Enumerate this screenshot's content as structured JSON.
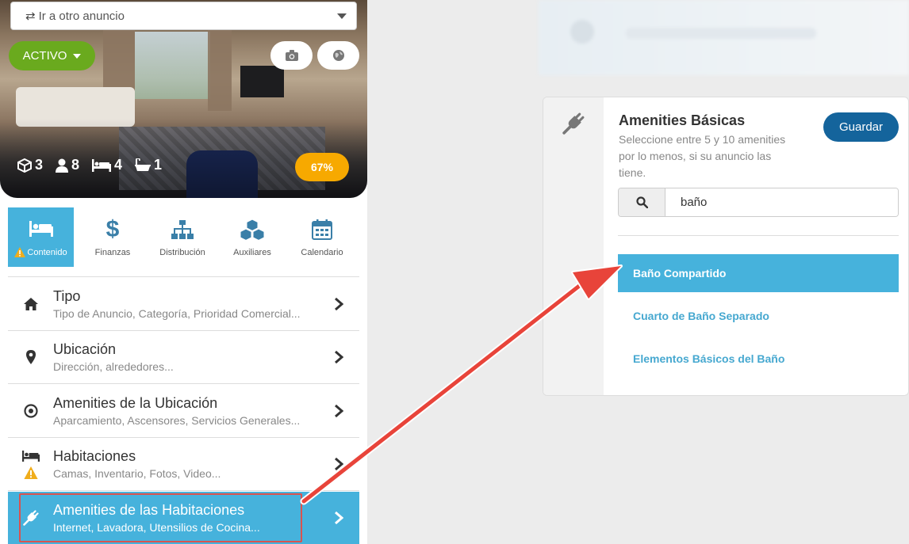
{
  "goto": {
    "label": "Ir a otro anuncio"
  },
  "status": {
    "label": "ACTIVO"
  },
  "stats": [
    {
      "icon": "cube-icon",
      "value": "3"
    },
    {
      "icon": "user-icon",
      "value": "8"
    },
    {
      "icon": "bed-icon",
      "value": "4"
    },
    {
      "icon": "bath-icon",
      "value": "1"
    }
  ],
  "progress": {
    "label": "67%",
    "percent": 67,
    "color": "#f7a900"
  },
  "tabs": [
    {
      "label": "Contenido",
      "icon": "bed-icon",
      "active": true,
      "warning": true
    },
    {
      "label": "Finanzas",
      "icon": "dollar-icon"
    },
    {
      "label": "Distribución",
      "icon": "sitemap-icon"
    },
    {
      "label": "Auxiliares",
      "icon": "cubes-icon"
    },
    {
      "label": "Calendario",
      "icon": "calendar-icon"
    }
  ],
  "menu": [
    {
      "title": "Tipo",
      "subtitle": "Tipo de Anuncio, Categoría, Prioridad Comercial...",
      "icon": "home-icon"
    },
    {
      "title": "Ubicación",
      "subtitle": "Dirección, alrededores...",
      "icon": "map-marker-icon"
    },
    {
      "title": "Amenities de la Ubicación",
      "subtitle": "Aparcamiento, Ascensores, Servicios Generales...",
      "icon": "target-icon"
    },
    {
      "title": "Habitaciones",
      "subtitle": "Camas, Inventario, Fotos, Video...",
      "icon": "bed-icon",
      "warning": true
    },
    {
      "title": "Amenities de las Habitaciones",
      "subtitle": "Internet, Lavadora, Utensilios de Cocina...",
      "icon": "plug-icon",
      "active": true
    }
  ],
  "card": {
    "icon": "plug-icon",
    "title": "Amenities Básicas",
    "description": "Seleccione entre 5 y 10 amenities por lo menos, si su anuncio las tiene.",
    "save_label": "Guardar",
    "search_value": "baño",
    "results": [
      {
        "label": "Baño Compartido",
        "selected": true
      },
      {
        "label": "Cuarto de Baño Separado"
      },
      {
        "label": "Elementos Básicos del Baño"
      }
    ]
  },
  "colors": {
    "accent": "#46b2dc",
    "primary": "#14649c",
    "success": "#6aaa1e",
    "warning": "#f7a900",
    "annotation": "#e8443a"
  }
}
